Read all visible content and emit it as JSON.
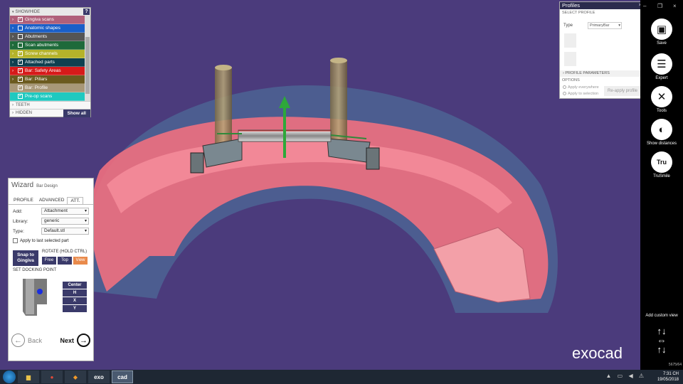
{
  "show_hide": {
    "header": "SHOW/HIDE",
    "help": "?",
    "items": [
      {
        "label": "Gingiva scans",
        "checked": true,
        "color": "#b0607a"
      },
      {
        "label": "Anatomic shapes",
        "checked": false,
        "color": "#1a5fc8"
      },
      {
        "label": "Abutments",
        "checked": false,
        "color": "#555555"
      },
      {
        "label": "Scan abutments",
        "checked": false,
        "color": "#1e6a3a"
      },
      {
        "label": "Screw channels",
        "checked": true,
        "color": "#b5b32a"
      },
      {
        "label": "Attached parts",
        "checked": true,
        "color": "#0e4050"
      },
      {
        "label": "Bar: Safety Areas",
        "checked": true,
        "color": "#d61a1a"
      },
      {
        "label": "Bar: Pillars",
        "checked": true,
        "color": "#6b5a1e"
      },
      {
        "label": "Bar: Profile",
        "checked": true,
        "color": "#a89878"
      },
      {
        "label": "Pre-op scans",
        "checked": true,
        "color": "#1fc9c0"
      }
    ],
    "teeth_label": "TEETH",
    "hidden_label": "HIDDEN",
    "show_all": "Show all"
  },
  "wizard": {
    "title": "Wizard",
    "subtitle": "Bar Design",
    "tabs": [
      "PROFILE",
      "ADVANCED",
      "ATT."
    ],
    "add_label": "Add:",
    "add_value": "Attachment",
    "library_label": "Library:",
    "library_value": "generic",
    "type_label": "Type:",
    "type_value": "Default.stl",
    "apply_last": "Apply to last selected part",
    "snap_button": "Snap to Gingiva",
    "rotate_label": "ROTATE (HOLD CTRL)",
    "rotate_buttons": [
      "Free",
      "Top",
      "View"
    ],
    "dock_label": "SET DOCKING POINT",
    "dock_buttons": [
      "Center",
      "H",
      "X",
      "Y"
    ],
    "back": "Back",
    "next": "Next"
  },
  "profiles": {
    "title": "Profiles",
    "select_profile": "SELECT PROFILE",
    "type_label": "Type",
    "type_value": "PrimaryBar",
    "parameters": "PROFILE PARAMETERS",
    "options": "OPTIONS",
    "apply_everywhere": "Apply everywhere",
    "apply_selection": "Apply to selection",
    "reapply": "Re-apply profile"
  },
  "toolbar": {
    "save": "Save",
    "expert": "Expert",
    "tools": "Tools",
    "show_distances": "Show distances",
    "trusmile": "TruSmile",
    "trusmile_icon_text": "Tru",
    "add_custom_view": "Add custom view",
    "version": "5675/64",
    "arrows_up": "↑↓",
    "arrows_mid": "⇔",
    "arrows_down": "↑↓"
  },
  "window_controls": {
    "close": "×",
    "minimize": "–",
    "restore": "❐"
  },
  "logo": "exocad",
  "taskbar": {
    "apps": [
      "",
      "",
      "",
      "",
      "exo",
      "cad"
    ],
    "time": "7:31 CH",
    "date": "19/05/2018",
    "tray_icons": "▲ ▭ ◀ ⚠"
  }
}
